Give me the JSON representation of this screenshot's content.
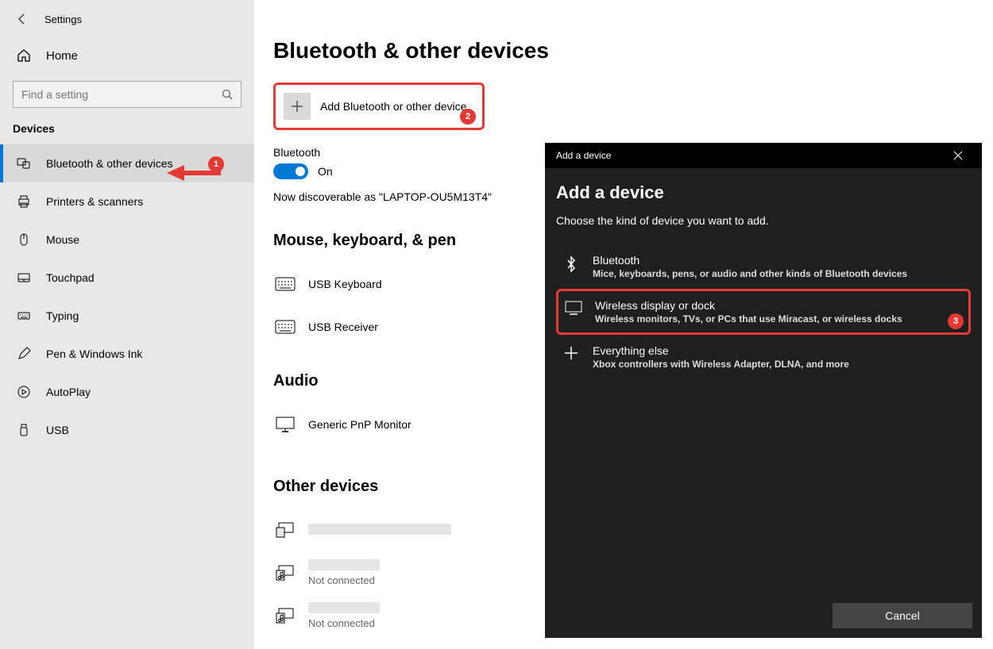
{
  "window_title": "Settings",
  "home_label": "Home",
  "search_placeholder": "Find a setting",
  "section_label": "Devices",
  "nav": [
    {
      "label": "Bluetooth & other devices",
      "active": true
    },
    {
      "label": "Printers & scanners"
    },
    {
      "label": "Mouse"
    },
    {
      "label": "Touchpad"
    },
    {
      "label": "Typing"
    },
    {
      "label": "Pen & Windows Ink"
    },
    {
      "label": "AutoPlay"
    },
    {
      "label": "USB"
    }
  ],
  "page_title": "Bluetooth & other devices",
  "add_device_label": "Add Bluetooth or other device",
  "bluetooth_label": "Bluetooth",
  "toggle_state": "On",
  "discoverable_text": "Now discoverable as \"LAPTOP-OU5M13T4\"",
  "section_mouse": "Mouse, keyboard, & pen",
  "devices_mouse": [
    {
      "name": "USB Keyboard"
    },
    {
      "name": "USB Receiver"
    }
  ],
  "section_audio": "Audio",
  "devices_audio": [
    {
      "name": "Generic PnP Monitor"
    }
  ],
  "section_other": "Other devices",
  "status_not_connected": "Not connected",
  "dialog": {
    "titlebar": "Add a device",
    "heading": "Add a device",
    "subtitle": "Choose the kind of device you want to add.",
    "options": [
      {
        "title": "Bluetooth",
        "desc": "Mice, keyboards, pens, or audio and other kinds of Bluetooth devices"
      },
      {
        "title": "Wireless display or dock",
        "desc": "Wireless monitors, TVs, or PCs that use Miracast, or wireless docks"
      },
      {
        "title": "Everything else",
        "desc": "Xbox controllers with Wireless Adapter, DLNA, and more"
      }
    ],
    "cancel": "Cancel"
  },
  "annotations": {
    "b1": "1",
    "b2": "2",
    "b3": "3"
  }
}
